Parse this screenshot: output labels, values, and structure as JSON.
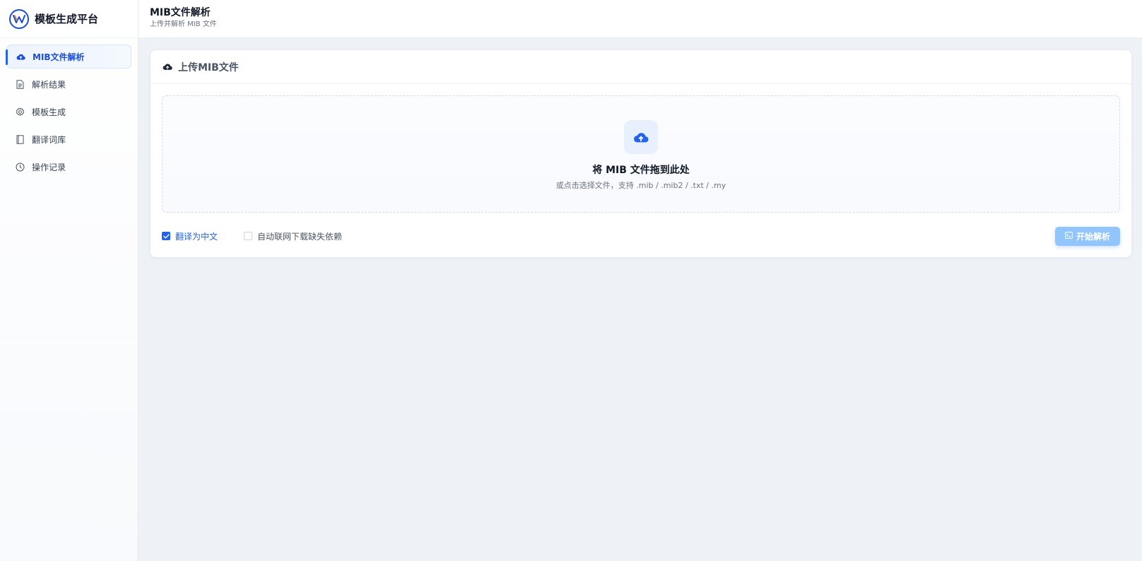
{
  "brand": {
    "name": "模板生成平台",
    "logo_icon": "w-logo-icon"
  },
  "sidebar": {
    "items": [
      {
        "label": "MIB文件解析",
        "icon": "cloud-upload-icon",
        "active": true
      },
      {
        "label": "解析结果",
        "icon": "document-icon",
        "active": false
      },
      {
        "label": "模板生成",
        "icon": "gear-icon",
        "active": false
      },
      {
        "label": "翻译词库",
        "icon": "book-icon",
        "active": false
      },
      {
        "label": "操作记录",
        "icon": "clock-icon",
        "active": false
      }
    ]
  },
  "header": {
    "title": "MIB文件解析",
    "subtitle": "上传并解析 MIB 文件"
  },
  "card": {
    "title": "上传MIB文件",
    "dropzone": {
      "title": "将 MIB 文件拖到此处",
      "hint": "或点击选择文件，支持 .mib / .mib2 / .txt / .my"
    },
    "options": [
      {
        "label": "翻译为中文",
        "checked": true
      },
      {
        "label": "自动联网下载缺失依赖",
        "checked": false
      }
    ],
    "start_button": {
      "label": "开始解析",
      "disabled": true
    }
  },
  "colors": {
    "accent": "#2563eb",
    "accent_light": "#93c5fd",
    "drop_icon_bg": "#e8f0fe"
  }
}
